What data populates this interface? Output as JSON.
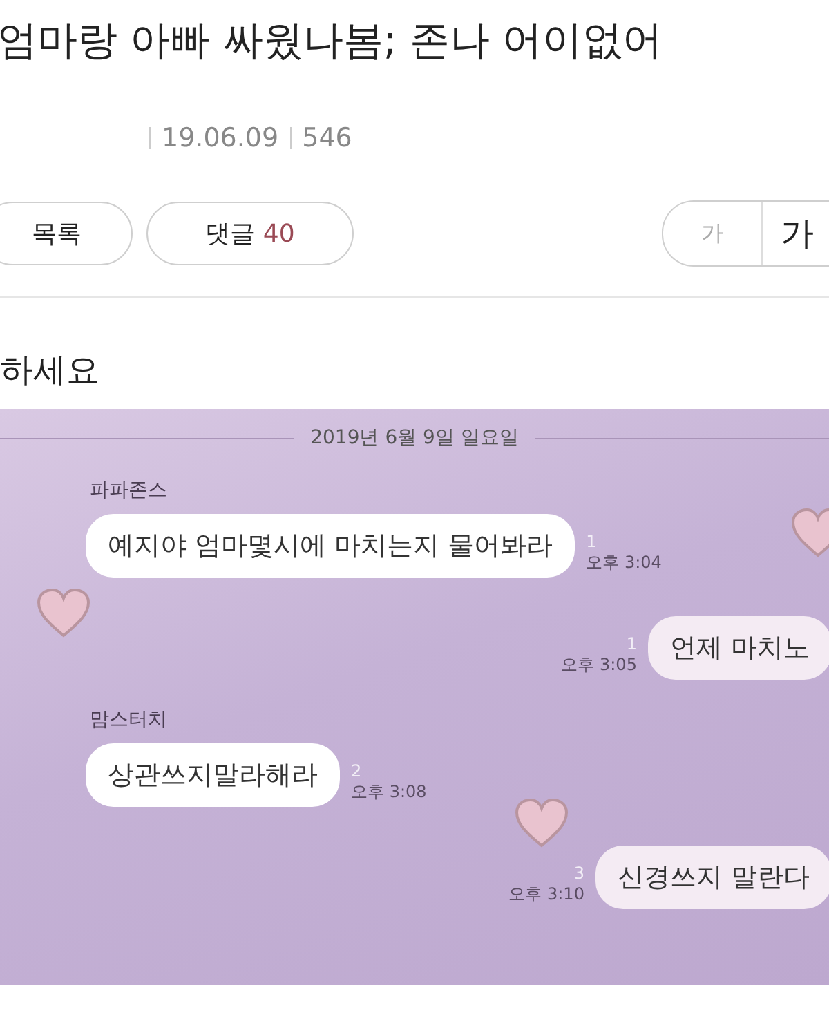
{
  "post": {
    "title": "엄마랑 아빠 싸웠나봄; 존나 어이없어",
    "date": "19.06.09",
    "views": "546"
  },
  "actions": {
    "list": "목록",
    "comments_label": "댓글",
    "comments_count": "40"
  },
  "font_size": {
    "small": "가",
    "large": "가"
  },
  "body_text": "하세요",
  "chat": {
    "date": "2019년 6월 9일 일요일",
    "messages": [
      {
        "kind": "received",
        "sender": "파파존스",
        "text": "예지야 엄마몇시에 마치는지 물어봐라",
        "unread": "1",
        "time": "오후 3:04"
      },
      {
        "kind": "sent",
        "text": "언제 마치노",
        "unread": "1",
        "time": "오후 3:05"
      },
      {
        "kind": "received",
        "sender": "맘스터치",
        "text": "상관쓰지말라해라",
        "unread": "2",
        "time": "오후 3:08"
      },
      {
        "kind": "sent",
        "text": "신경쓰지 말란다",
        "unread": "3",
        "time": "오후 3:10"
      }
    ]
  }
}
